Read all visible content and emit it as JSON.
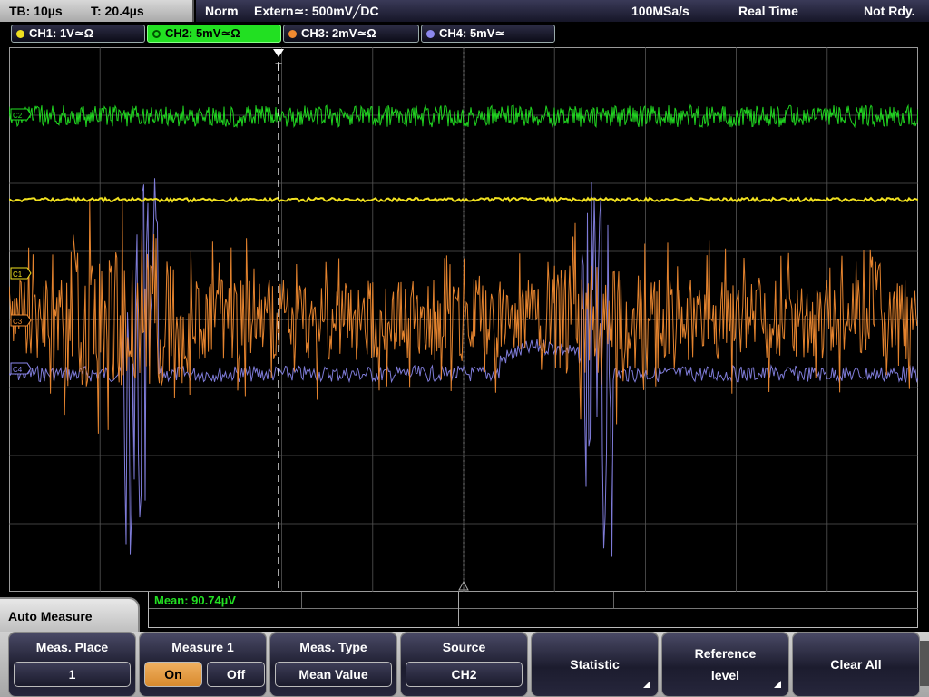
{
  "status": {
    "timebase": "TB: 10µs",
    "trigger_time": "T: 20.4µs",
    "mode": "Norm",
    "trigger_source": "Extern≃: 500mV╱DC",
    "sample_rate": "100MSa/s",
    "acquisition": "Real Time",
    "state": "Not Rdy."
  },
  "channels": [
    {
      "label": "CH1: 1V≃Ω",
      "color": "#f0e020"
    },
    {
      "label": "CH2: 5mV≃Ω",
      "color": "#22e022"
    },
    {
      "label": "CH3: 2mV≃Ω",
      "color": "#f08a30"
    },
    {
      "label": "CH4: 5mV≃",
      "color": "#8c88ee"
    }
  ],
  "markers": {
    "ch1": "C1",
    "ch2": "C2",
    "ch3": "C3",
    "ch4": "C4",
    "trigger": "T"
  },
  "measurement": {
    "readout": "Mean: 90.74µV"
  },
  "menu": {
    "title": "Auto Measure",
    "place_title": "Meas. Place",
    "place_value": "1",
    "measure_title": "Measure 1",
    "on_label": "On",
    "off_label": "Off",
    "type_title": "Meas. Type",
    "type_value": "Mean Value",
    "source_title": "Source",
    "source_value": "CH2",
    "statistic_label": "Statistic",
    "reference_label_1": "Reference",
    "reference_label_2": "level",
    "clear_label": "Clear All"
  },
  "colors": {
    "ch1": "#f0e020",
    "ch2": "#22e022",
    "ch3": "#f08a30",
    "ch4": "#8c88ee",
    "grid": "#555555"
  }
}
